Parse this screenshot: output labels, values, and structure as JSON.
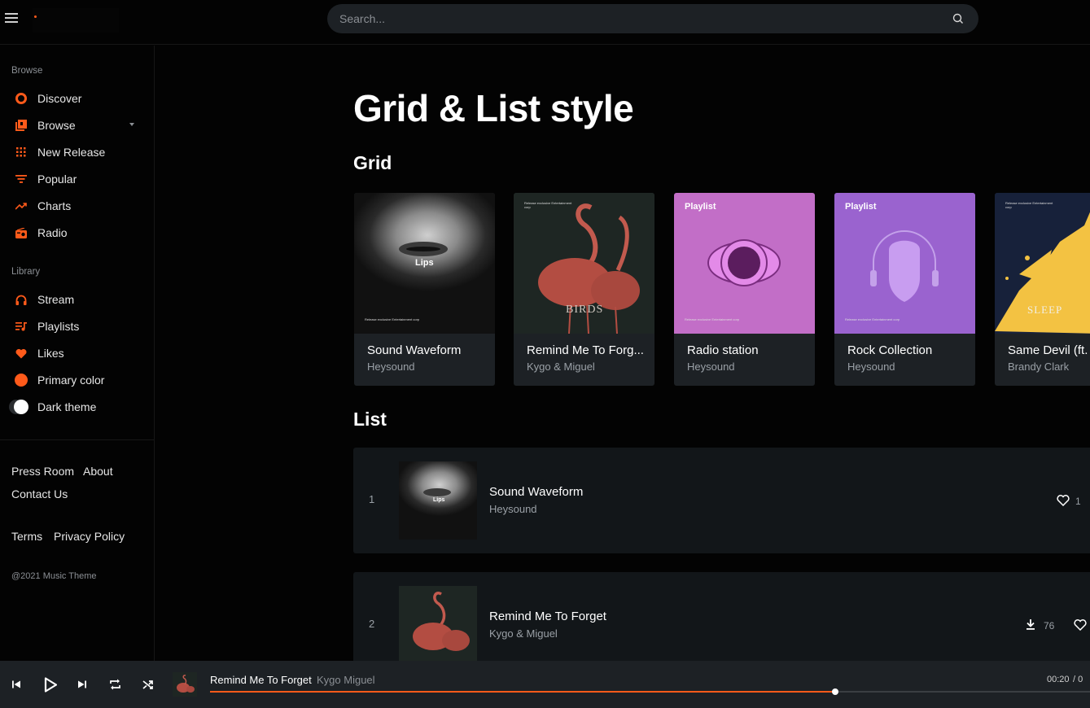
{
  "search": {
    "placeholder": "Search..."
  },
  "sidebar": {
    "browse_heading": "Browse",
    "library_heading": "Library",
    "browse_items": [
      {
        "label": "Discover",
        "icon": "disc-icon"
      },
      {
        "label": "Browse",
        "icon": "library-icon"
      },
      {
        "label": "New Release",
        "icon": "grid-icon"
      },
      {
        "label": "Popular",
        "icon": "sort-icon"
      },
      {
        "label": "Charts",
        "icon": "trending-icon"
      },
      {
        "label": "Radio",
        "icon": "radio-icon"
      }
    ],
    "library_items": [
      {
        "label": "Stream",
        "icon": "headphones-icon"
      },
      {
        "label": "Playlists",
        "icon": "playlist-icon"
      },
      {
        "label": "Likes",
        "icon": "heart-icon"
      },
      {
        "label": "Primary color",
        "icon": "color-dot-icon"
      },
      {
        "label": "Dark theme",
        "icon": "toggle-icon"
      }
    ],
    "footer_links": [
      "Press Room",
      "About",
      "Contact Us",
      "Terms",
      "Privacy Policy"
    ],
    "copyright": "@2021 Music Theme"
  },
  "main": {
    "title": "Grid & List style",
    "grid_heading": "Grid",
    "list_heading": "List",
    "grid": [
      {
        "title": "Sound Waveform",
        "artist": "Heysound",
        "cover_text": "Lips"
      },
      {
        "title": "Remind Me To Forg...",
        "artist": "Kygo & Miguel",
        "cover_text": "BIRDS"
      },
      {
        "title": "Radio station",
        "artist": "Heysound",
        "cover_text": "Playlist"
      },
      {
        "title": "Rock Collection",
        "artist": "Heysound",
        "cover_text": "Playlist"
      },
      {
        "title": "Same Devil (ft. I",
        "artist": "Brandy Clark",
        "cover_text": "SLEEP"
      }
    ],
    "cover_small_text": "Release exclusive Entertainment corp",
    "list": [
      {
        "num": "1",
        "title": "Sound Waveform",
        "artist": "Heysound",
        "likes": "1"
      },
      {
        "num": "2",
        "title": "Remind Me To Forget",
        "artist": "Kygo & Miguel",
        "downloads": "76"
      }
    ]
  },
  "player": {
    "title": "Remind Me To Forget",
    "artist": "Kygo Miguel",
    "current_time": "00:20",
    "duration_partial": "/ 0",
    "progress": 0.71
  },
  "colors": {
    "accent": "#ff5a1a",
    "background": "#030303",
    "card": "#1d2125"
  }
}
